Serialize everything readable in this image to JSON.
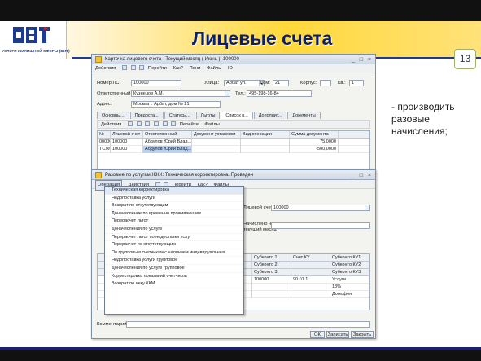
{
  "slide": {
    "title": "Лицевые счета",
    "page_number": "13",
    "note": "- производить разовые начисления;",
    "logo_text": "УСЛУГИ ЖИЛИЩНОЙ СФЕРЫ (БИТ)"
  },
  "main_window": {
    "title": "Карточка лицевого счета - Текущий месяц ( Июнь ): 100000",
    "toolbar": [
      "Действия",
      "Перейти",
      "Как?",
      "Пени",
      "Файлы",
      "ID"
    ],
    "fields": {
      "account_label": "Номер ЛС:",
      "account_value": "100000",
      "street_label": "Улица:",
      "street_value": "Арбат ул.",
      "house_label": "Дом:",
      "house_value": "21",
      "building_label": "Корпус:",
      "apt_label": "Кв.:",
      "apt_value": "1",
      "responsible_label": "Ответственный:",
      "responsible_value": "Кузнецов А.М.",
      "phone_label": "Тел.:",
      "phone_value": "495-198-16-84",
      "address_label": "Адрес:",
      "address_value": "Москва г. Арбат, дом № 21"
    },
    "tabs": [
      "Основны...",
      "Предоста...",
      "Статусы...",
      "Льготы",
      "Список в...",
      "Дополнит...",
      "Документы"
    ],
    "subtoolbar": [
      "Действия",
      "Перейти",
      "Файлы"
    ],
    "grid": {
      "headers": [
        "№",
        "Лицевой счет",
        "Ответственный",
        "Документ установки",
        "Вид операции",
        "Сумма документа"
      ],
      "rows": [
        [
          "000000...",
          "100000",
          "Абдулов Юрий Влад...",
          "",
          "",
          "75,0000"
        ],
        [
          "ТСЖ00...",
          "100000",
          "Абдулов Юрий Влад...",
          "",
          "",
          "-500,0000"
        ]
      ]
    }
  },
  "sub_window": {
    "title": "Разовые по услугам ЖКХ: Техническая корректировка. Проведен",
    "toolbar": [
      "Операция",
      "Действия",
      "Перейти",
      "Как?",
      "Файлы"
    ],
    "fields": {
      "account_label": "Лицевой счет:",
      "account_value": "100000",
      "note_label": "Начислено на",
      "note_label2": "текущий месяц"
    },
    "grid": {
      "headers": [
        "Субконто 1",
        "Счет КУ",
        "Субконто КУ1"
      ],
      "headers2": [
        "Субконто 2",
        "",
        "Субконто КУ2"
      ],
      "headers3": [
        "Субконто 3",
        "",
        "Субконто КУ3"
      ],
      "rows": [
        [
          "100000",
          "90.01.1",
          "Услуги"
        ],
        [
          "",
          "",
          "18%"
        ],
        [
          "",
          "",
          "Домофон"
        ]
      ]
    },
    "comment_label": "Комментарий:",
    "buttons": {
      "ok": "ОК",
      "save": "Записать",
      "close": "Закрыть"
    }
  },
  "operation_menu": {
    "items": [
      "Техническая корректировка",
      "Недопоставка услуги",
      "Возврат по отсутствующим",
      "Доначисление по временно проживающим",
      "Перерасчет льгот",
      "Доначисления по услуге",
      "Перерасчет льгот по недоставки услуг",
      "Перерасчет по отсутствующим",
      "По групповым счетчикам с наличием индивидуальных",
      "Недопоставка услуги групповое",
      "Доначисления по услуге групповое",
      "Корректировка показаний счетчиков",
      "Возврат по чеку ККМ"
    ]
  },
  "colors": {
    "title": "#0d1e6e",
    "brand_blue": "#1e3b8f",
    "yellow": "#ffd83a"
  }
}
